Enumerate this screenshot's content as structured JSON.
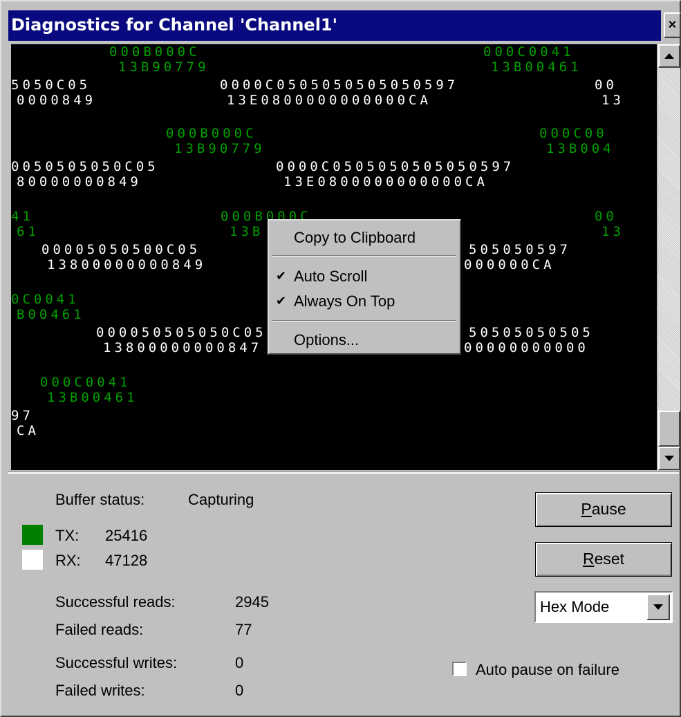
{
  "window": {
    "title": "Diagnostics for Channel 'Channel1'",
    "close_glyph": "×"
  },
  "display": {
    "tx_color": "#00a000",
    "rx_color": "#ffffff",
    "lines": [
      {
        "type": "tx",
        "text": "000B000C"
      },
      {
        "type": "tx",
        "text": "000C0041"
      },
      {
        "type": "tx",
        "text": "13B90779"
      },
      {
        "type": "tx",
        "text": "13B00461"
      },
      {
        "type": "rx",
        "text": "5050C05"
      },
      {
        "type": "rx",
        "text": "0000C0505050505050597"
      },
      {
        "type": "rx",
        "text": "00"
      },
      {
        "type": "rx",
        "text": "0000849"
      },
      {
        "type": "rx",
        "text": "13E0800000000000CA"
      },
      {
        "type": "rx",
        "text": "13"
      },
      {
        "type": "tx",
        "text": "000B000C"
      },
      {
        "type": "tx",
        "text": "000C00"
      },
      {
        "type": "tx",
        "text": "13B90779"
      },
      {
        "type": "tx",
        "text": "13B004"
      },
      {
        "type": "rx",
        "text": "0050505050C05"
      },
      {
        "type": "rx",
        "text": "0000C0505050505050597"
      },
      {
        "type": "rx",
        "text": "80000000849"
      },
      {
        "type": "rx",
        "text": "13E0800000000000CA"
      },
      {
        "type": "tx",
        "text": "41"
      },
      {
        "type": "tx",
        "text": "000B000C"
      },
      {
        "type": "tx",
        "text": "00"
      },
      {
        "type": "tx",
        "text": "61"
      },
      {
        "type": "tx",
        "text": "13B"
      },
      {
        "type": "tx",
        "text": "13"
      },
      {
        "type": "rx",
        "text": "00005050500C05"
      },
      {
        "type": "rx",
        "text": "505050597"
      },
      {
        "type": "rx",
        "text": "13800000000849"
      },
      {
        "type": "rx",
        "text": "000000CA"
      },
      {
        "type": "tx",
        "text": "0C0041"
      },
      {
        "type": "tx",
        "text": "B00461"
      },
      {
        "type": "rx",
        "text": "000050505050C05"
      },
      {
        "type": "rx",
        "text": "50505050505"
      },
      {
        "type": "rx",
        "text": "13800000000847"
      },
      {
        "type": "rx",
        "text": "00000000000"
      },
      {
        "type": "tx",
        "text": "000C0041"
      },
      {
        "type": "tx",
        "text": "13B00461"
      },
      {
        "type": "rx",
        "text": "97"
      },
      {
        "type": "rx",
        "text": "CA"
      }
    ]
  },
  "context_menu": {
    "copy": "Copy to Clipboard",
    "auto_scroll": "Auto Scroll",
    "auto_scroll_checked": true,
    "always_on_top": "Always On Top",
    "always_on_top_checked": true,
    "options": "Options..."
  },
  "status": {
    "buffer_label": "Buffer status:",
    "buffer_value": "Capturing",
    "tx_label": "TX:",
    "tx_value": "25416",
    "rx_label": "RX:",
    "rx_value": "47128",
    "successful_reads_label": "Successful reads:",
    "successful_reads": "2945",
    "failed_reads_label": "Failed reads:",
    "failed_reads": "77",
    "successful_writes_label": "Successful writes:",
    "successful_writes": "0",
    "failed_writes_label": "Failed writes:",
    "failed_writes": "0"
  },
  "controls": {
    "pause_label_accel": "P",
    "pause_label_rest": "ause",
    "reset_label_accel": "R",
    "reset_label_rest": "eset",
    "mode_selected": "Hex Mode",
    "auto_pause_label": "Auto pause on failure",
    "auto_pause_checked": false
  }
}
